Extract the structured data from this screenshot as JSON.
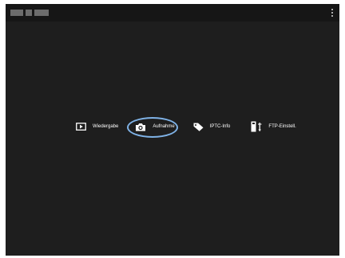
{
  "titlebar": {
    "icon_name": "menu-kebab-icon"
  },
  "nav": {
    "items": [
      {
        "label": "Wiedergabe",
        "icon": "playback-icon"
      },
      {
        "label": "Aufnahme",
        "icon": "camera-icon"
      },
      {
        "label": "IPTC-Info",
        "icon": "tag-icon"
      },
      {
        "label": "FTP-Einstell.",
        "icon": "ftp-icon"
      }
    ],
    "selected": "Aufnahme",
    "highlight_color": "#7fb2e6"
  },
  "colors": {
    "background": "#1e1e1e",
    "titlebar": "#161616",
    "text": "#ffffff"
  }
}
